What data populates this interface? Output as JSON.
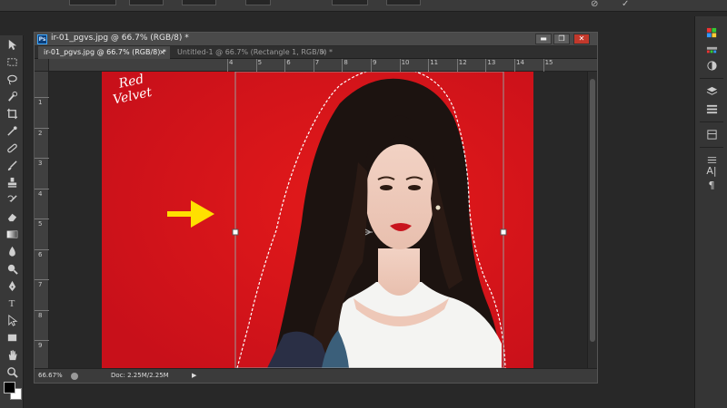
{
  "document": {
    "window_title": "ir-01_pgvs.jpg @ 66.7% (RGB/8) *",
    "tabs": [
      {
        "label": "ir-01_pgvs.jpg @ 66.7% (RGB/8) *",
        "active": true
      },
      {
        "label": "Untitled-1 @ 66.7% (Rectangle 1, RGB/8) *",
        "active": false
      }
    ],
    "window_controls": {
      "minimize": "▬",
      "maximize": "❐",
      "close": "✕"
    },
    "ruler_top": [
      "4",
      "5",
      "6",
      "7",
      "8",
      "9",
      "10",
      "11",
      "12",
      "13",
      "14",
      "15"
    ],
    "ruler_left": [
      "1",
      "2",
      "3",
      "4",
      "5",
      "6",
      "7",
      "8",
      "9"
    ],
    "artwork_text": {
      "logo_line1": "Red",
      "logo_line2": "Velvet"
    },
    "status": {
      "zoom": "66.67%",
      "doc_size": "Doc: 2.25M/2.25M",
      "menu_arrow": "▶"
    }
  },
  "tab_close_glyph": "×",
  "toolbar": {
    "tools": [
      "move-icon",
      "marquee-icon",
      "lasso-icon",
      "quick-select-icon",
      "crop-icon",
      "eyedropper-icon",
      "healing-brush-icon",
      "brush-icon",
      "clone-stamp-icon",
      "history-brush-icon",
      "eraser-icon",
      "gradient-icon",
      "blur-icon",
      "dodge-icon",
      "pen-icon",
      "type-icon",
      "path-select-icon",
      "shape-icon",
      "hand-icon",
      "zoom-icon"
    ],
    "type_glyph": "T"
  },
  "right_panel": {
    "icons": [
      "color-icon",
      "swatches-icon",
      "adjust-icon",
      "layers-icon",
      "channels-icon",
      "paths-icon",
      "properties-icon",
      "character-icon",
      "paragraph-icon"
    ],
    "character_glyph": "A|",
    "paragraph_glyph": "¶"
  },
  "colors": {
    "photo_red": "#d81818",
    "annotation_arrow": "#ffe000",
    "workspace": "#282828"
  }
}
